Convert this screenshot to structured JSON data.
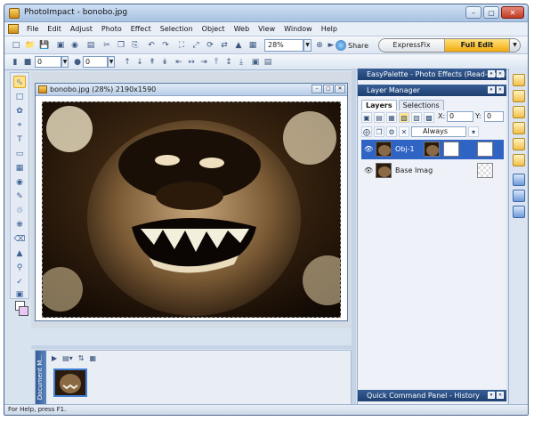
{
  "window": {
    "title": "PhotoImpact - bonobo.jpg"
  },
  "menu": [
    "File",
    "Edit",
    "Adjust",
    "Photo",
    "Effect",
    "Selection",
    "Object",
    "Web",
    "View",
    "Window",
    "Help"
  ],
  "toolbar": {
    "zoom": "28%",
    "share_label": "Share",
    "mode_express": "ExpressFix",
    "mode_full": "Full Edit"
  },
  "toolbar2": {
    "spin1": "0",
    "spin2": "0"
  },
  "document": {
    "title": "bonobo.jpg (28%) 2190x1590"
  },
  "filmstrip": {
    "label": "Document M..."
  },
  "panels": {
    "easypalette_title": "EasyPalette - Photo Effects (Read-only)",
    "layer_manager_title": "Layer Manager",
    "tabs": [
      "Layers",
      "Selections"
    ],
    "x_label": "X:",
    "x_value": "0",
    "y_label": "Y:",
    "y_value": "0",
    "merge_option": "Always",
    "layers": [
      {
        "name": "Obj-1",
        "selected": true
      },
      {
        "name": "Base Imag",
        "selected": false
      }
    ],
    "history_title": "Quick Command Panel - History"
  },
  "status": {
    "text": "For Help, press F1."
  },
  "colors": {
    "accent": "#2f63c4",
    "title_gradient": "#365d95",
    "full_edit": "#f2a90f"
  }
}
